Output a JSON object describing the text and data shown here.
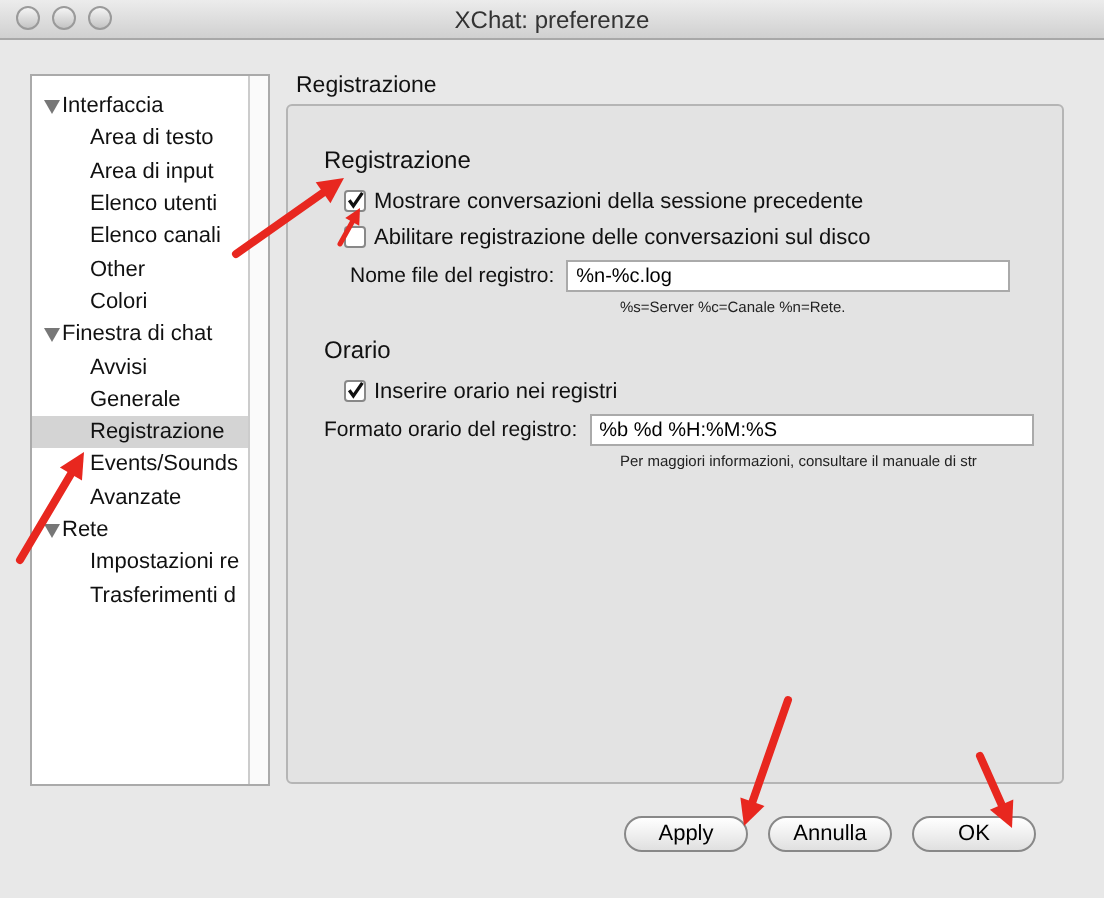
{
  "window": {
    "title": "XChat: preferenze"
  },
  "sidebar": {
    "items": [
      {
        "label": "Interfaccia",
        "expanded": true,
        "selected": false,
        "children": [
          {
            "label": "Area di testo",
            "selected": false
          },
          {
            "label": "Area di input",
            "selected": false
          },
          {
            "label": "Elenco utenti",
            "selected": false
          },
          {
            "label": "Elenco canali",
            "selected": false
          },
          {
            "label": "Other",
            "selected": false
          },
          {
            "label": "Colori",
            "selected": false
          }
        ]
      },
      {
        "label": "Finestra di chat",
        "expanded": true,
        "selected": false,
        "children": [
          {
            "label": "Avvisi",
            "selected": false
          },
          {
            "label": "Generale",
            "selected": false
          },
          {
            "label": "Registrazione",
            "selected": true
          },
          {
            "label": "Events/Sounds",
            "selected": false
          },
          {
            "label": "Avanzate",
            "selected": false
          }
        ]
      },
      {
        "label": "Rete",
        "expanded": true,
        "selected": false,
        "children": [
          {
            "label": "Impostazioni re",
            "selected": false
          },
          {
            "label": "Trasferimenti d",
            "selected": false
          }
        ]
      }
    ]
  },
  "page": {
    "title": "Registrazione",
    "sections": [
      {
        "title": "Registrazione",
        "rows": [
          {
            "kind": "checkbox",
            "label": "Mostrare conversazioni della sessione precedente",
            "checked": true
          },
          {
            "kind": "checkbox",
            "label": "Abilitare registrazione delle conversazioni sul disco",
            "checked": false
          },
          {
            "kind": "field",
            "label": "Nome file del registro:",
            "value": "%n-%c.log",
            "indent": true
          },
          {
            "kind": "hint",
            "text": "%s=Server %c=Canale %n=Rete."
          }
        ]
      },
      {
        "title": "Orario",
        "rows": [
          {
            "kind": "checkbox",
            "label": "Inserire orario nei registri",
            "checked": true
          },
          {
            "kind": "field",
            "label": "Formato orario del registro:",
            "value": "%b %d %H:%M:%S",
            "indent": false
          },
          {
            "kind": "hint",
            "text": "Per maggiori informazioni, consultare il manuale di str"
          }
        ]
      }
    ]
  },
  "buttons": [
    "Apply",
    "Annulla",
    "OK"
  ]
}
